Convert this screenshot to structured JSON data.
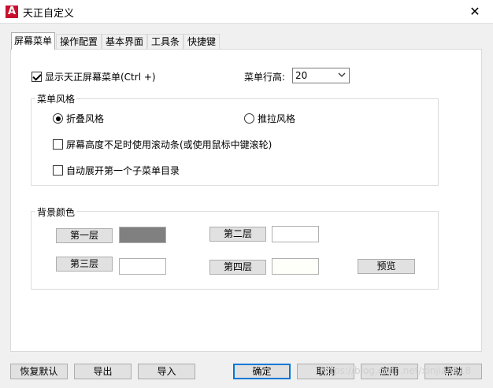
{
  "window": {
    "title": "天正自定义",
    "logo": "A",
    "close_glyph": "✕"
  },
  "tabs": [
    {
      "label": "屏幕菜单",
      "active": true
    },
    {
      "label": "操作配置",
      "active": false
    },
    {
      "label": "基本界面",
      "active": false
    },
    {
      "label": "工具条",
      "active": false
    },
    {
      "label": "快捷键",
      "active": false
    }
  ],
  "screen_menu": {
    "show_menu": {
      "label": "显示天正屏幕菜单(Ctrl +)",
      "checked": true
    },
    "row_height": {
      "label": "菜单行高:",
      "value": "20"
    }
  },
  "menu_style": {
    "title": "菜单风格",
    "fold": {
      "label": "折叠风格",
      "selected": true
    },
    "push": {
      "label": "推拉风格",
      "selected": false
    },
    "scrollbar": {
      "label": "屏幕高度不足时使用滚动条(或使用鼠标中键滚轮)",
      "checked": false
    },
    "auto_expand": {
      "label": "自动展开第一个子菜单目录",
      "checked": false
    }
  },
  "background": {
    "title": "背景颜色",
    "layer1": {
      "label": "第一层",
      "color": "#808080"
    },
    "layer2": {
      "label": "第二层",
      "color": "#ffffff"
    },
    "layer3": {
      "label": "第三层",
      "color": "#ffffff"
    },
    "layer4": {
      "label": "第四层",
      "color": "#fffffa"
    },
    "preview_label": "预览"
  },
  "footer": {
    "restore_default": "恢复默认",
    "export": "导出",
    "import": "导入",
    "ok": "确定",
    "cancel": "取消",
    "apply": "应用",
    "help": "帮助"
  },
  "watermark": "https://blog.csdn.net/xinjian618"
}
